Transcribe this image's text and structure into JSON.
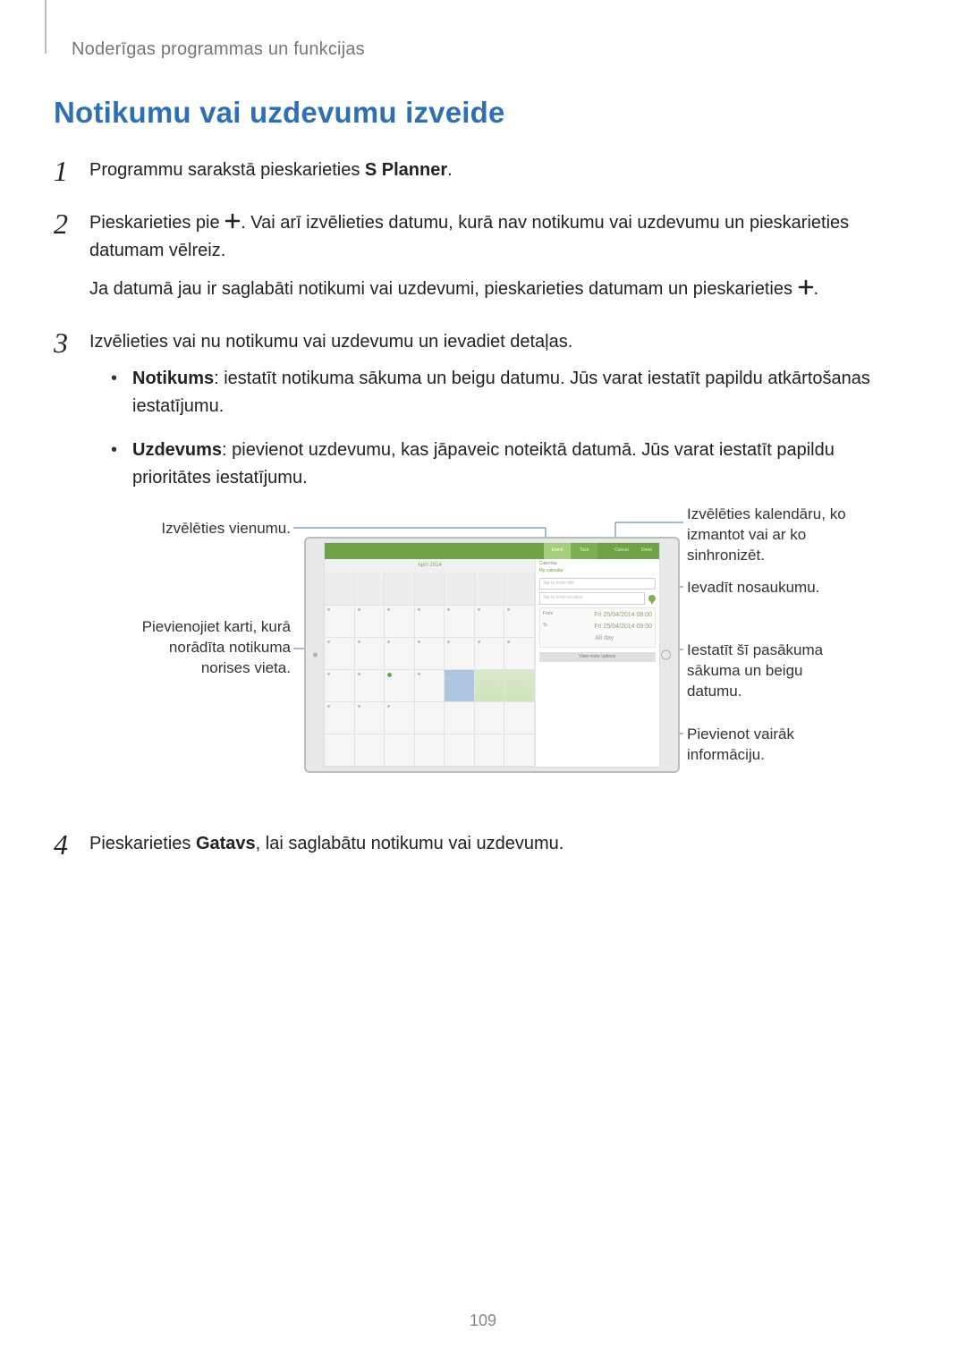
{
  "header": "Noderīgas programmas un funkcijas",
  "heading": "Notikumu vai uzdevumu izveide",
  "steps": {
    "s1_a": "Programmu sarakstā pieskarieties ",
    "s1_b": "S Planner",
    "s1_c": ".",
    "s2_a": "Pieskarieties pie ",
    "s2_b": ". Vai arī izvēlieties datumu, kurā nav notikumu vai uzdevumu un pieskarieties datumam vēlreiz.",
    "s2_sub_a": "Ja datumā jau ir saglabāti notikumi vai uzdevumi, pieskarieties datumam un pieskarieties ",
    "s2_sub_b": ".",
    "s3_a": "Izvēlieties vai nu notikumu vai uzdevumu un ievadiet detaļas.",
    "s3_b1_label": "Notikums",
    "s3_b1_text": ": iestatīt notikuma sākuma un beigu datumu. Jūs varat iestatīt papildu atkārtošanas iestatījumu.",
    "s3_b2_label": "Uzdevums",
    "s3_b2_text": ": pievienot uzdevumu, kas jāpaveic noteiktā datumā. Jūs varat iestatīt papildu prioritātes iestatījumu.",
    "s4_a": "Pieskarieties ",
    "s4_b": "Gatavs",
    "s4_c": ", lai saglabātu notikumu vai uzdevumu."
  },
  "callouts": {
    "left1": "Izvēlēties vienumu.",
    "left2": "Pievienojiet karti, kurā norādīta notikuma norises vieta.",
    "right1": "Izvēlēties kalendāru, ko izmantot vai ar ko sinhronizēt.",
    "right2": "Ievadīt nosaukumu.",
    "right3": "Iestatīt šī pasākuma sākuma un beigu datumu.",
    "right4": "Pievienot vairāk informāciju."
  },
  "screenshot": {
    "tabs": {
      "event": "Event",
      "task": "Task"
    },
    "actions": {
      "cancel": "Cancel",
      "done": "Done"
    },
    "month": "April 2014",
    "calendar_label": "Calendar",
    "calendar_value": "My calendar",
    "title_placeholder": "Tap to enter title",
    "location_placeholder": "Tap to enter location",
    "from_label": "From",
    "from_value": "Fri 25/04/2014 08:00",
    "to_label": "To",
    "to_value": "Fri 25/04/2014 09:00",
    "allday": "All day",
    "more": "View more options"
  },
  "pagenum": "109"
}
